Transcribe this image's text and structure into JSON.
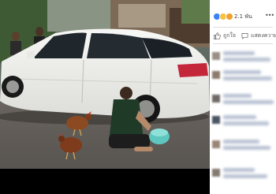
{
  "post": {
    "reaction_count": "2.1 พัน",
    "actions": {
      "like_label": "ถูกใจ",
      "comment_label": "แสดงความคิดเห็น"
    },
    "menu_icon": "more-dots-icon"
  },
  "colors": {
    "like": "#3b82f6",
    "haha": "#f5c242",
    "wow": "#f0a030",
    "link_blue": "#385898"
  }
}
